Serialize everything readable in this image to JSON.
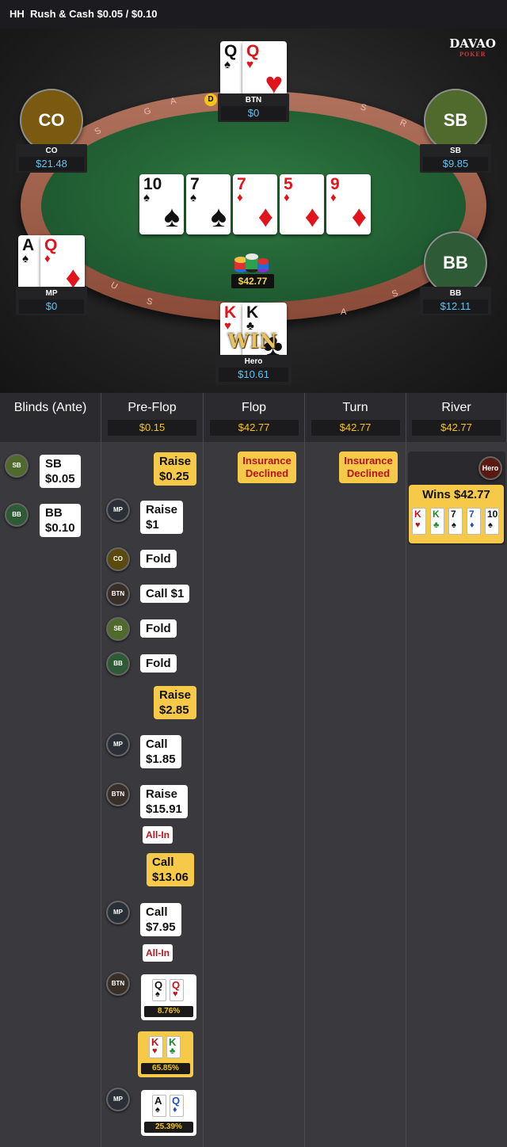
{
  "header": {
    "label": "HH",
    "title": "Rush & Cash $0.05 / $0.10"
  },
  "logo": {
    "main": "DAVAO",
    "sub": "POKER"
  },
  "table": {
    "dealer_button": "D",
    "pot": "$42.77",
    "win_text": "WIN",
    "board": [
      {
        "rank": "10",
        "suit": "♠",
        "color": "blk"
      },
      {
        "rank": "7",
        "suit": "♠",
        "color": "blk"
      },
      {
        "rank": "7",
        "suit": "♦",
        "color": "red"
      },
      {
        "rank": "5",
        "suit": "♦",
        "color": "red"
      },
      {
        "rank": "9",
        "suit": "♦",
        "color": "red"
      }
    ],
    "seats": {
      "btn": {
        "name": "BTN",
        "stack": "$0",
        "cards": [
          {
            "rank": "Q",
            "suit": "♠",
            "color": "blk"
          },
          {
            "rank": "Q",
            "suit": "♥",
            "color": "red"
          }
        ]
      },
      "co": {
        "name": "CO",
        "label": "CO",
        "stack": "$21.48"
      },
      "sb": {
        "name": "SB",
        "label": "SB",
        "stack": "$9.85"
      },
      "mp": {
        "name": "MP",
        "stack": "$0",
        "cards": [
          {
            "rank": "A",
            "suit": "♠",
            "color": "blk"
          },
          {
            "rank": "Q",
            "suit": "♦",
            "color": "red"
          }
        ]
      },
      "bb": {
        "name": "BB",
        "label": "BB",
        "stack": "$12.11"
      },
      "hero": {
        "name": "Hero",
        "stack": "$10.61",
        "cards": [
          {
            "rank": "K",
            "suit": "♥",
            "color": "red"
          },
          {
            "rank": "K",
            "suit": "♣",
            "color": "blk"
          }
        ]
      }
    },
    "colors": {
      "co": "#7a5a10",
      "sb": "#4f6a2c",
      "bb": "#2e5a35"
    }
  },
  "streets": [
    {
      "name": "Blinds (Ante)",
      "pot": ""
    },
    {
      "name": "Pre-Flop",
      "pot": "$0.15"
    },
    {
      "name": "Flop",
      "pot": "$42.77"
    },
    {
      "name": "Turn",
      "pot": "$42.77"
    },
    {
      "name": "River",
      "pot": "$42.77"
    }
  ],
  "blinds": [
    {
      "pos": "SB",
      "line1": "SB",
      "line2": "$0.05"
    },
    {
      "pos": "BB",
      "line1": "BB",
      "line2": "$0.10"
    }
  ],
  "preflop": [
    {
      "pos": "",
      "line1": "Raise",
      "line2": "$0.25",
      "hero": true
    },
    {
      "pos": "MP",
      "line1": "Raise",
      "line2": "$1"
    },
    {
      "pos": "CO",
      "line1": "Fold",
      "line2": ""
    },
    {
      "pos": "BTN",
      "line1": "Call  $1",
      "line2": ""
    },
    {
      "pos": "SB",
      "line1": "Fold",
      "line2": ""
    },
    {
      "pos": "BB",
      "line1": "Fold",
      "line2": ""
    },
    {
      "pos": "",
      "line1": "Raise",
      "line2": "$2.85",
      "hero": true
    },
    {
      "pos": "MP",
      "line1": "Call",
      "line2": "$1.85"
    },
    {
      "pos": "BTN",
      "line1": "Raise",
      "line2": "$15.91",
      "allin": "All-In"
    },
    {
      "pos": "",
      "line1": "Call",
      "line2": "$13.06",
      "hero": true
    },
    {
      "pos": "MP",
      "line1": "Call",
      "line2": "$7.95",
      "allin": "All-In"
    }
  ],
  "equity": [
    {
      "pos": "BTN",
      "cards": [
        {
          "rank": "Q",
          "suit": "♠"
        },
        {
          "rank": "Q",
          "suit": "♥"
        }
      ],
      "pct": "8.76%"
    },
    {
      "pos": "",
      "cards": [
        {
          "rank": "K",
          "suit": "♥"
        },
        {
          "rank": "K",
          "suit": "♣"
        }
      ],
      "pct": "65.85%",
      "hero": true
    },
    {
      "pos": "MP",
      "cards": [
        {
          "rank": "A",
          "suit": "♠"
        },
        {
          "rank": "Q",
          "suit": "♦"
        }
      ],
      "pct": "25.39%"
    }
  ],
  "flop": {
    "insurance": "Insurance Declined"
  },
  "turn": {
    "insurance": "Insurance Declined"
  },
  "river": {
    "who": "Hero",
    "result": "Wins $42.77",
    "cards": [
      {
        "rank": "K",
        "suit": "♥"
      },
      {
        "rank": "K",
        "suit": "♣"
      },
      {
        "rank": "7",
        "suit": "♠"
      },
      {
        "rank": "7",
        "suit": "♦"
      },
      {
        "rank": "10",
        "suit": "♠"
      }
    ]
  }
}
